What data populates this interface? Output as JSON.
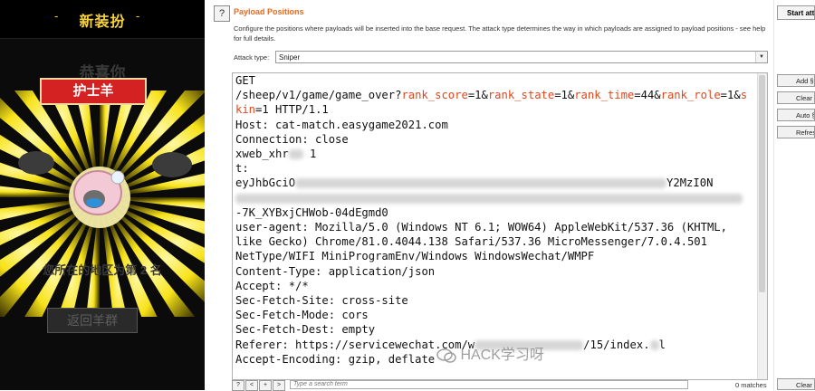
{
  "game": {
    "header_left": "-",
    "header_title": "新装扮",
    "header_right": "-",
    "congrats": "恭喜你",
    "ribbon": "护士羊",
    "rank_text": "您所在的地区为第 2 名",
    "back_button": "返回羊群"
  },
  "burp": {
    "help": "?",
    "title": "Payload Positions",
    "description": "Configure the positions where payloads will be inserted into the base request. The attack type determines the way in which payloads are assigned to payload positions - see help for full details.",
    "attack_label": "Attack type:",
    "attack_value": "Sniper",
    "buttons": {
      "start": "Start attack",
      "add": "Add §",
      "clear": "Clear §",
      "auto": "Auto §",
      "refresh": "Refresh",
      "clear_bottom": "Clear"
    },
    "request": {
      "l1": "GET",
      "path_pre": "/sheep/v1/game/game_over?",
      "p1": "rank_score",
      "v1": "=1&",
      "p2": "rank_state",
      "v2": "=1&",
      "p3": "rank_time",
      "v3": "=44&",
      "p4": "rank_role",
      "v4": "=1&",
      "p5a": "sk",
      "p5b": "in",
      "v5": "=1 HTTP/1.1",
      "host": "Host: cat-match.easygame2021.com",
      "conn": "Connection: close",
      "xweb": "xweb_xhr",
      "xweb_tail": " 1",
      "t": "t:",
      "token_start": "eyJhbGciO",
      "token_end": "Y2MzI0N",
      "token_tail": "-7K_XYBxjCHWob-04dEgmd0",
      "ua1": "user-agent: Mozilla/5.0 (Windows NT 6.1; WOW64) AppleWebKit/537.36 (KHTML,",
      "ua2": "like Gecko) Chrome/81.0.4044.138 Safari/537.36 MicroMessenger/7.0.4.501",
      "ua3": "NetType/WIFI MiniProgramEnv/Windows WindowsWechat/WMPF",
      "ctype": "Content-Type: application/json",
      "accept": "Accept: */*",
      "sfs": "Sec-Fetch-Site: cross-site",
      "sfm": "Sec-Fetch-Mode: cors",
      "sfd": "Sec-Fetch-Dest: empty",
      "referer_a": "Referer: https://servicewechat.com/w",
      "referer_b": "/15/index.",
      "referer_c": "l",
      "accept_enc": "Accept-Encoding: gzip, deflate"
    },
    "search_placeholder": "Type a search term",
    "matches": "0 matches",
    "nav": [
      "?",
      "<",
      "+",
      ">"
    ]
  },
  "watermark": "HACK学习呀",
  "colors": {
    "accent_orange": "#e8691e",
    "payload_marker": "#e0461b",
    "ribbon_red": "#d42222",
    "burst_yellow": "#f7e21a"
  }
}
